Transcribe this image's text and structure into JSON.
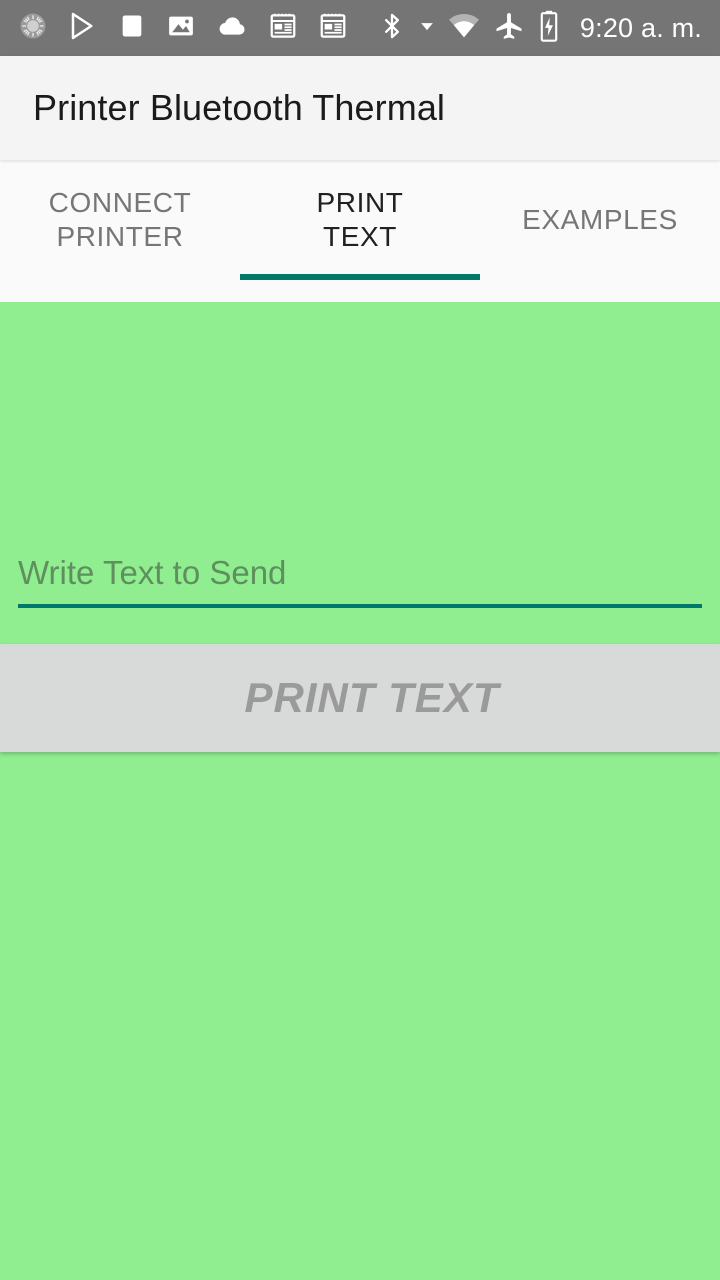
{
  "status_bar": {
    "background": "#757575",
    "time": "9:20 a. m.",
    "left_icons": [
      "sync-spinner-icon",
      "play-store-icon",
      "square-icon",
      "photo-icon",
      "cloud-icon",
      "news-article-icon",
      "news-article-alt-icon"
    ],
    "right_icons": [
      "bluetooth-icon",
      "dropdown-caret-icon",
      "wifi-icon",
      "airplane-mode-icon",
      "battery-charging-icon"
    ]
  },
  "app_bar": {
    "title": "Printer Bluetooth Thermal",
    "background": "#F4F4F4",
    "title_color": "#1B1B1B"
  },
  "tabs": {
    "indicator_color": "#00796B",
    "active_index": 1,
    "items": [
      {
        "label": "CONNECT\nPRINTER",
        "selected": false
      },
      {
        "label": "PRINT\nTEXT",
        "selected": true
      },
      {
        "label": "EXAMPLES",
        "selected": false
      }
    ]
  },
  "main": {
    "background": "#90EE90",
    "text_input": {
      "value": "",
      "placeholder": "Write Text to Send",
      "underline_color": "#00796B"
    },
    "print_button": {
      "label": "PRINT TEXT",
      "enabled": false,
      "background": "#D8D9D9",
      "text_color": "#9A9A9A"
    }
  }
}
